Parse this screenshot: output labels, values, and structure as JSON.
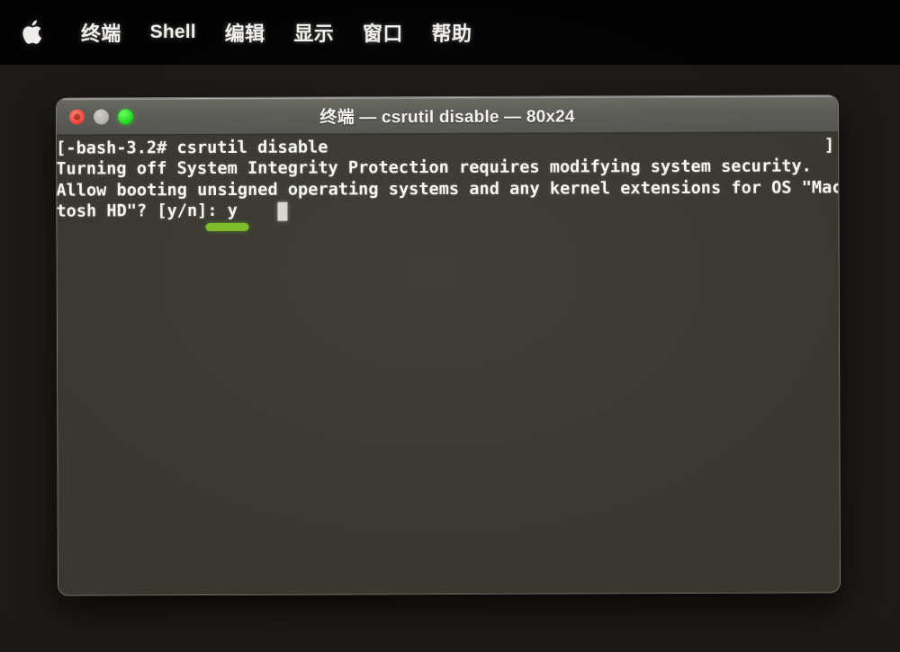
{
  "menubar": {
    "apple_icon": "apple-logo-icon",
    "items": [
      {
        "label": "终端"
      },
      {
        "label": "Shell"
      },
      {
        "label": "编辑"
      },
      {
        "label": "显示"
      },
      {
        "label": "窗口"
      },
      {
        "label": "帮助"
      }
    ]
  },
  "window": {
    "title": "终端 — csrutil disable — 80x24",
    "traffic_lights": {
      "close": "close-button",
      "minimize": "minimize-button",
      "zoom": "zoom-button"
    },
    "colors": {
      "titlebar_bg": "#5d5d58",
      "terminal_bg": "#383830",
      "terminal_fg": "#f6f5f0",
      "desktop_bg": "#1c1a17",
      "menubar_bg": "#030303",
      "highlight_green": "#7cbd26",
      "cursor": "#d7d5cd",
      "light_close": "#f04a3a",
      "light_minimize": "#b4b2ab",
      "light_zoom": "#24dd1f"
    }
  },
  "terminal": {
    "prompt_line": "[-bash-3.2# csrutil disable",
    "wrap_marker": "]",
    "lines": [
      "[-bash-3.2# csrutil disable",
      "Turning off System Integrity Protection requires modifying system security.",
      "Allow booting unsigned operating systems and any kernel extensions for OS \"Macin",
      "tosh HD\"? [y/n]: y"
    ],
    "command": "csrutil disable",
    "prompt": "[-bash-3.2#",
    "typed_answer": "y",
    "cursor": "block-cursor",
    "size": "80x24"
  }
}
